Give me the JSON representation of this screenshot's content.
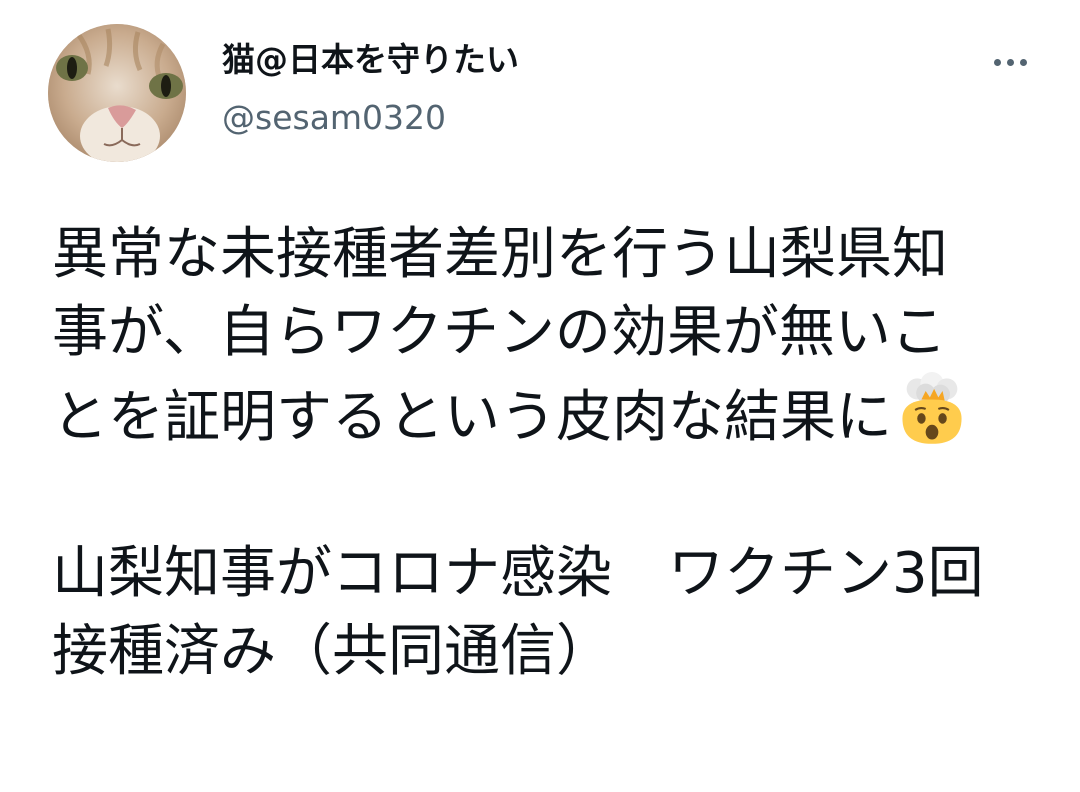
{
  "user": {
    "display_name": "猫@日本を守りたい",
    "handle": "@sesam0320",
    "avatar_icon": "cat-face-photo"
  },
  "menu": {
    "more_icon": "more-horizontal-icon"
  },
  "tweet": {
    "paragraph1": "異常な未接種者差別を行う山梨県知事が、自らワクチンの効果が無いことを証明するという皮肉な結果に",
    "emoji_name": "exploding-head-emoji",
    "paragraph2": "山梨知事がコロナ感染　ワクチン3回接種済み（共同通信）"
  },
  "colors": {
    "text": "#0f1419",
    "secondary": "#536471",
    "background": "#ffffff"
  }
}
